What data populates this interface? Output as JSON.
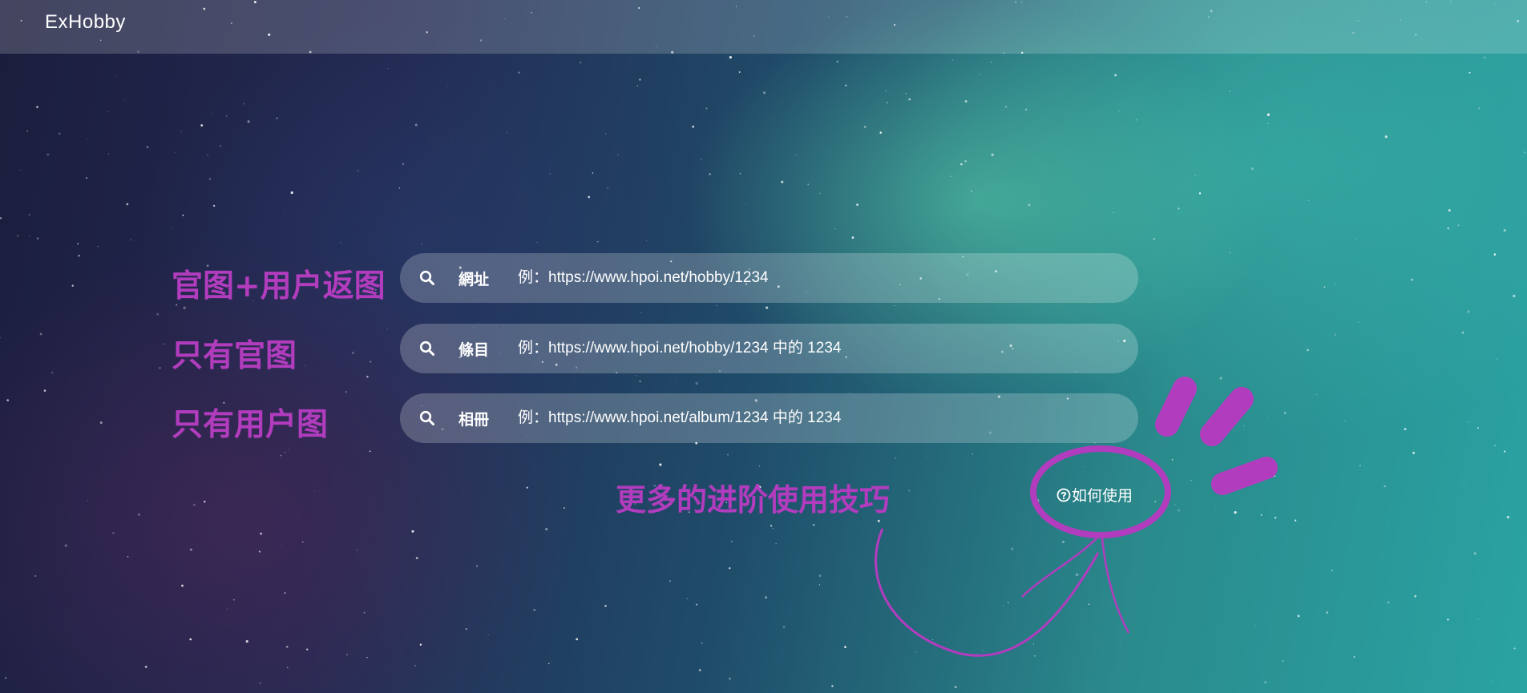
{
  "header": {
    "brand": "ExHobby"
  },
  "rows": [
    {
      "annotation": "官图+用户返图",
      "label": "網址",
      "placeholder": "例：https://www.hpoi.net/hobby/1234"
    },
    {
      "annotation": "只有官图",
      "label": "條目",
      "placeholder": "例：https://www.hpoi.net/hobby/1234 中的 1234"
    },
    {
      "annotation": "只有用户图",
      "label": "相冊",
      "placeholder": "例：https://www.hpoi.net/album/1234 中的 1234"
    }
  ],
  "annotations": {
    "more_tips": "更多的进阶使用技巧"
  },
  "help": {
    "label": "如何使用",
    "icon": "question-circle-icon"
  },
  "colors": {
    "annotation": "#b23cbe",
    "text": "#ffffff"
  }
}
